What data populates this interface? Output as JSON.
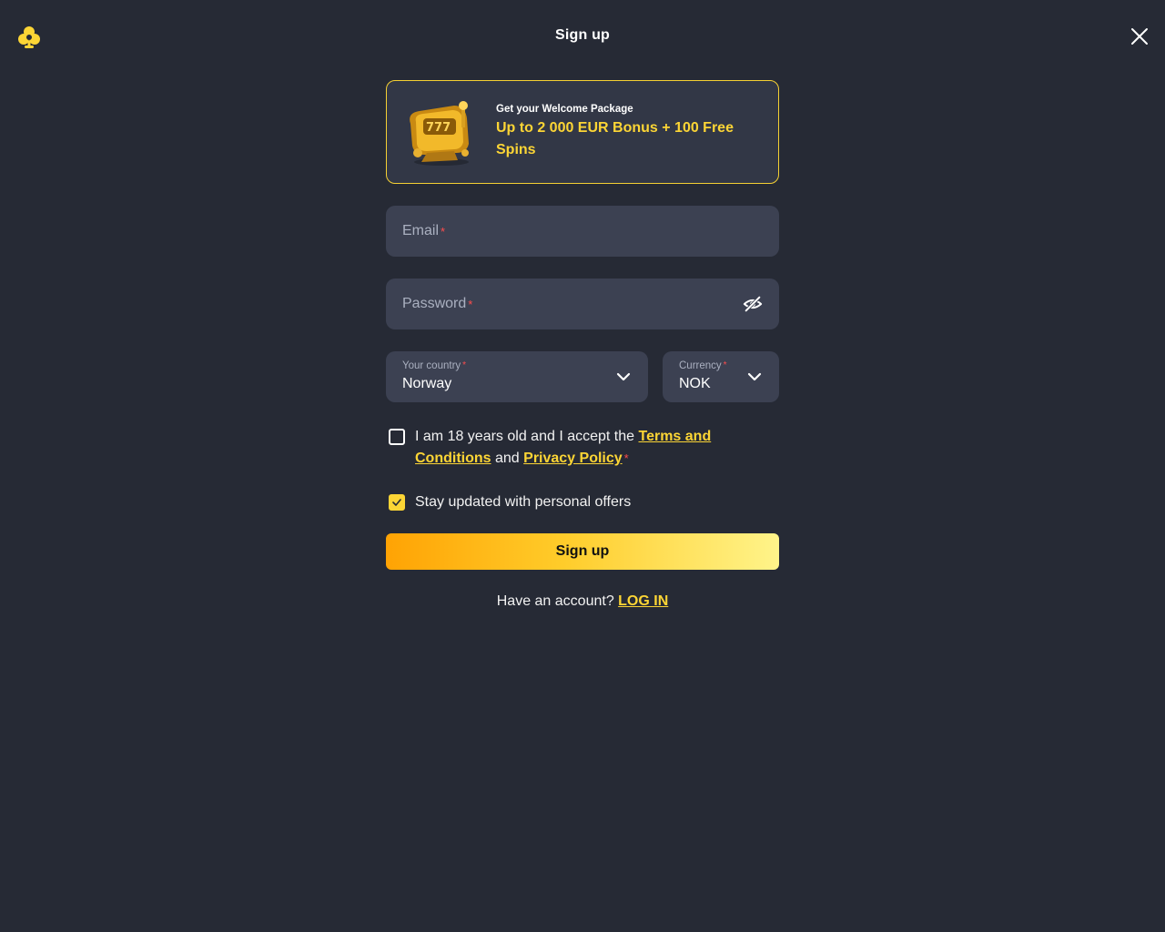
{
  "header": {
    "title": "Sign up",
    "logo_icon": "clover-logo-icon",
    "close_icon": "close-icon"
  },
  "promo": {
    "subtitle": "Get your Welcome Package",
    "headline": "Up to 2 000 EUR Bonus + 100 Free Spins",
    "image_icon": "slot-machine-icon"
  },
  "email": {
    "placeholder": "Email",
    "required_mark": "*"
  },
  "password": {
    "placeholder": "Password",
    "required_mark": "*",
    "toggle_icon": "eye-off-icon"
  },
  "country": {
    "label": "Your country",
    "required_mark": "*",
    "value": "Norway"
  },
  "currency": {
    "label": "Currency",
    "required_mark": "*",
    "value": "NOK"
  },
  "terms": {
    "checked": false,
    "text_before": "I am 18 years old and I accept the ",
    "terms_link": "Terms and Conditions",
    "text_middle": " and ",
    "privacy_link": "Privacy Policy",
    "required_mark": "*"
  },
  "offers": {
    "checked": true,
    "label": "Stay updated with personal offers"
  },
  "submit": {
    "label": "Sign up"
  },
  "login": {
    "text": "Have an account? ",
    "link": "LOG IN"
  },
  "colors": {
    "background": "#262a35",
    "field": "#3c4152",
    "accent": "#fcd535",
    "required": "#ff4d4d"
  }
}
